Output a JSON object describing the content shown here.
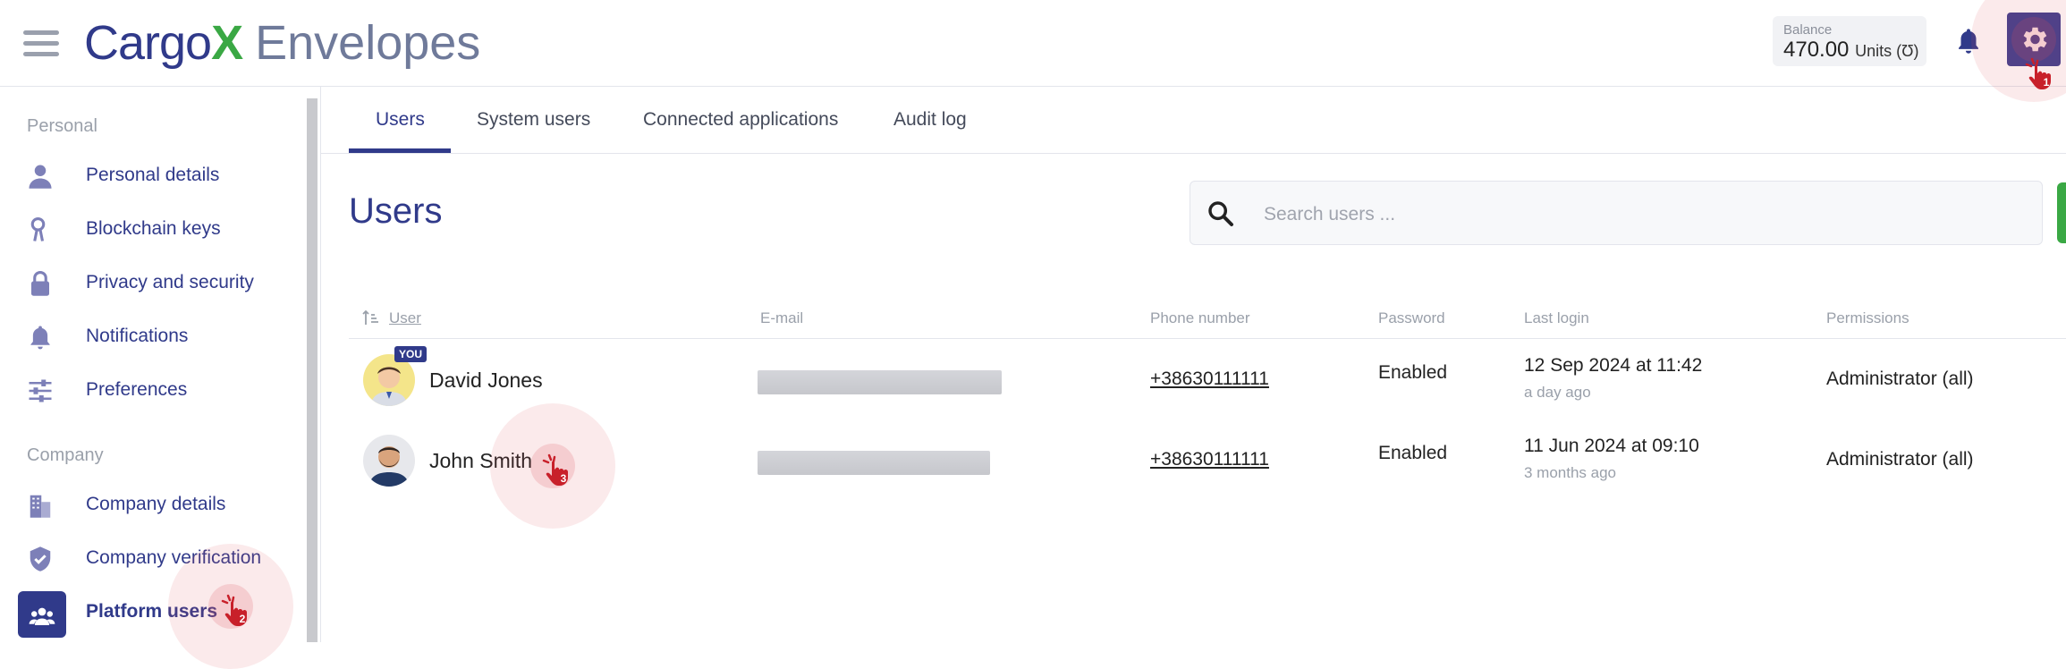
{
  "header": {
    "logo_main": "Cargo",
    "logo_x": "X",
    "logo_product": "Envelopes",
    "balance_label": "Balance",
    "balance_value": "470.00",
    "balance_unit": "Units (Ʊ)"
  },
  "sidebar": {
    "section_personal": "Personal",
    "section_company": "Company",
    "items": [
      {
        "label": "Personal details",
        "icon": "person-icon"
      },
      {
        "label": "Blockchain keys",
        "icon": "key-icon"
      },
      {
        "label": "Privacy and security",
        "icon": "lock-icon"
      },
      {
        "label": "Notifications",
        "icon": "bell-icon"
      },
      {
        "label": "Preferences",
        "icon": "sliders-icon"
      },
      {
        "label": "Company details",
        "icon": "building-icon"
      },
      {
        "label": "Company verification",
        "icon": "shield-check-icon"
      },
      {
        "label": "Platform users",
        "icon": "users-icon"
      }
    ]
  },
  "tabs": [
    {
      "label": "Users"
    },
    {
      "label": "System users"
    },
    {
      "label": "Connected applications"
    },
    {
      "label": "Audit log"
    }
  ],
  "main": {
    "title": "Users",
    "search_placeholder": "Search users ..."
  },
  "table": {
    "columns": [
      "User",
      "E-mail",
      "Phone number",
      "Password",
      "Last login",
      "Permissions"
    ],
    "you_badge": "YOU",
    "rows": [
      {
        "name": "David Jones",
        "phone": "+38630111111",
        "password": "Enabled",
        "last_login": "12 Sep 2024 at 11:42",
        "last_login_rel": "a day ago",
        "permissions": "Administrator (all)"
      },
      {
        "name": "John Smith",
        "phone": "+38630111111",
        "password": "Enabled",
        "last_login": "11 Jun 2024 at 09:10",
        "last_login_rel": "3 months ago",
        "permissions": "Administrator (all)"
      }
    ]
  },
  "markers": [
    "1",
    "2",
    "3"
  ],
  "colors": {
    "brand": "#303a8a",
    "accent_green": "#3aa844",
    "marker_red": "#c8202a"
  }
}
